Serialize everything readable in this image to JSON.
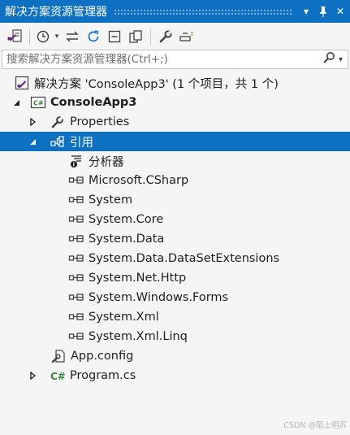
{
  "window": {
    "title": "解决方案资源管理器",
    "controls": {
      "dropdown": "▾",
      "pin": "ᛘ",
      "close": "✕"
    }
  },
  "toolbar": {
    "icons": [
      "vs-solution-icon",
      "history-icon",
      "sync-icon",
      "refresh-icon",
      "collapse-all-icon",
      "copy-icon",
      "wrench-icon",
      "preview-icon"
    ]
  },
  "search": {
    "placeholder": "搜索解决方案资源管理器(Ctrl+;)",
    "value": ""
  },
  "tree": {
    "solution": "解决方案 'ConsoleApp3' (1 个项目，共 1 个)",
    "project": "ConsoleApp3",
    "properties": "Properties",
    "references": "引用",
    "analyzers": "分析器",
    "ref_items": [
      "Microsoft.CSharp",
      "System",
      "System.Core",
      "System.Data",
      "System.Data.DataSetExtensions",
      "System.Net.Http",
      "System.Windows.Forms",
      "System.Xml",
      "System.Xml.Linq"
    ],
    "app_config": "App.config",
    "program": "Program.cs"
  },
  "colors": {
    "accent": "#0e70c0",
    "vs_purple": "#68217a",
    "csharp_green": "#388a34"
  },
  "watermark": "CSDN @陌上明苏"
}
